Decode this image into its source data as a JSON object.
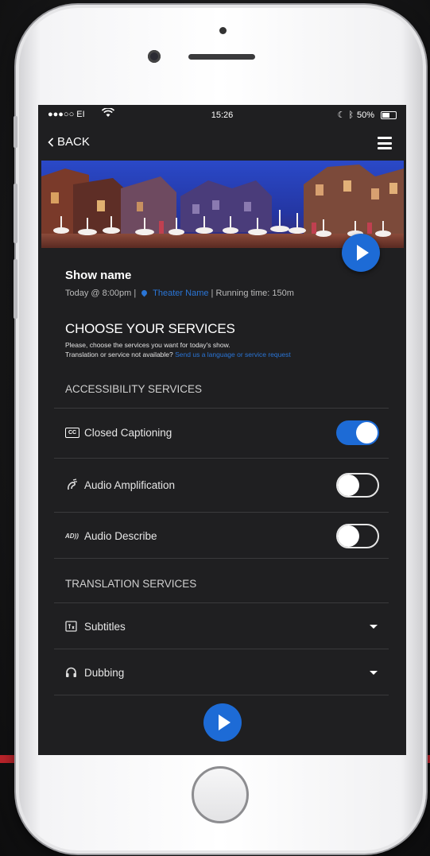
{
  "status_bar": {
    "carrier": "●●●○○ EI",
    "time": "15:26",
    "battery": "50%"
  },
  "nav": {
    "back_label": "BACK"
  },
  "show": {
    "name": "Show name",
    "date": "Today @ 8:00pm",
    "separator": "|",
    "theater": "Theater Name",
    "running_time": "Running time: 150m"
  },
  "choose": {
    "title": "CHOOSE YOUR SERVICES",
    "line1": "Please, choose the services you want for today's show.",
    "line2_prefix": "Translation or service not available?",
    "line2_link": "Send us a language or service request"
  },
  "accessibility": {
    "heading": "ACCESSIBILITY SERVICES",
    "items": [
      {
        "label": "Closed Captioning",
        "icon": "closed-captioning-icon",
        "enabled": true
      },
      {
        "label": "Audio Amplification",
        "icon": "audio-amplification-icon",
        "enabled": false
      },
      {
        "label": "Audio Describe",
        "icon": "audio-describe-icon",
        "enabled": false
      }
    ]
  },
  "translation": {
    "heading": "TRANSLATION SERVICES",
    "items": [
      {
        "label": "Subtitles",
        "icon": "subtitles-icon"
      },
      {
        "label": "Dubbing",
        "icon": "headphones-icon"
      }
    ]
  },
  "colors": {
    "accent": "#1d6bd6",
    "background": "#1f1f21",
    "link": "#2a75d6"
  }
}
